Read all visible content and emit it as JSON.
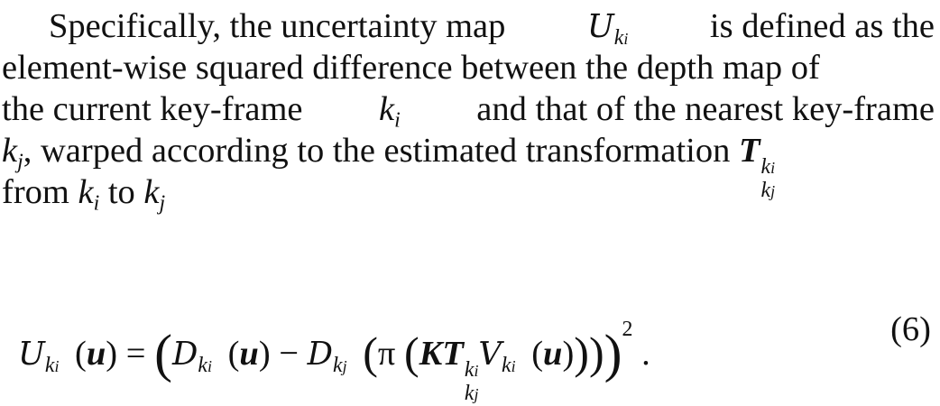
{
  "paragraph": {
    "line1": {
      "text_a": "Specifically, the uncertainty map",
      "symbol": "U",
      "symbol_sub": "k",
      "symbol_subsub": "i",
      "text_b": "is defined as the"
    },
    "line2": {
      "text": "element-wise squared difference between the depth map of"
    },
    "line3": {
      "text_a": "the current key-frame",
      "var": "k",
      "var_sub": "i",
      "text_b": "and that of the nearest key-frame"
    },
    "line4": {
      "var": "k",
      "var_sub": "j",
      "text_a": ", warped according to the estimated transformation",
      "T": "T",
      "T_sup": "k",
      "T_supsub": "i",
      "T_sub": "k",
      "T_subsub": "j"
    },
    "line5": {
      "text_a": "from",
      "var1": "k",
      "var1_sub": "i",
      "text_b": "to",
      "var2": "k",
      "var2_sub": "j"
    }
  },
  "equation": {
    "lhs_symbol": "U",
    "lhs_sub": "k",
    "lhs_subsub": "i",
    "arg_u": "u",
    "equals": "=",
    "D": "D",
    "minus": "−",
    "pi": "π",
    "K": "K",
    "T": "T",
    "V": "V",
    "sub_i": "i",
    "sub_j": "j",
    "k": "k",
    "exponent": "2",
    "period": ".",
    "number": "(6)"
  }
}
